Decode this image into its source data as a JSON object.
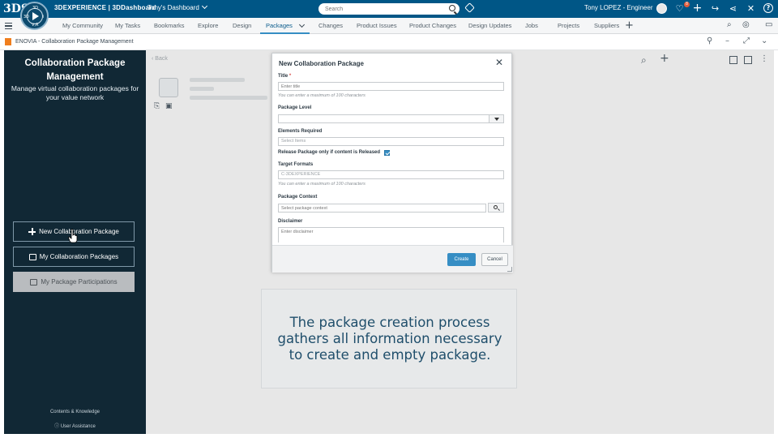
{
  "topbar": {
    "logo": "3DS",
    "compass_labels": {
      "top": "3D",
      "left": "3D",
      "right": "i",
      "bottom": "V,R"
    },
    "brand": "3DEXPERIENCE | 3DDashboard",
    "dashboard_name": "Tony's Dashboard",
    "search_placeholder": "Search",
    "user_name": "Tony LOPEZ - Engineer",
    "notifications_count": "8"
  },
  "tabs": [
    {
      "label": "My Community"
    },
    {
      "label": "My Tasks"
    },
    {
      "label": "Bookmarks"
    },
    {
      "label": "Explore"
    },
    {
      "label": "Design"
    },
    {
      "label": "Packages",
      "active": true
    },
    {
      "label": "Changes"
    },
    {
      "label": "Product Issues"
    },
    {
      "label": "Product Changes"
    },
    {
      "label": "Design Updates"
    },
    {
      "label": "Jobs"
    },
    {
      "label": "Projects"
    },
    {
      "label": "Suppliers"
    }
  ],
  "widget": {
    "title": "ENOVIA - Collaboration Package Management"
  },
  "leftpanel": {
    "title_line1": "Collaboration Package",
    "title_line2": "Management",
    "subtitle": "Manage virtual collaboration packages for your value network",
    "buttons": {
      "new": "New Collaboration Package",
      "mine": "My Collaboration Packages",
      "participations": "My Package Participations"
    },
    "footer": {
      "contents": "Contents & Knowledge",
      "assistance": "User Assistance"
    }
  },
  "main": {
    "back_label": "‹ Back"
  },
  "modal": {
    "title": "New Collaboration Package",
    "fields": {
      "title_label": "Title",
      "title_required_mark": "*",
      "title_placeholder": "Enter title",
      "title_hint": "You can enter a maximum of 100 characters",
      "level_label": "Package Level",
      "elements_label": "Elements Required",
      "elements_placeholder": "Select Items",
      "release_label": "Release Package only if content is Released",
      "formats_label": "Target Formats",
      "formats_value": "C-3DEXPERIENCE",
      "formats_hint": "You can enter a maximum of 100 characters",
      "context_label": "Package Context",
      "context_placeholder": "Select package context",
      "disclaimer_label": "Disclaimer",
      "disclaimer_placeholder": "Enter disclaimer"
    },
    "create_label": "Create",
    "cancel_label": "Cancel"
  },
  "caption": {
    "text_line1": "The package creation process",
    "text_line2": "gathers all information necessary",
    "text_line3": "to create and empty package."
  }
}
